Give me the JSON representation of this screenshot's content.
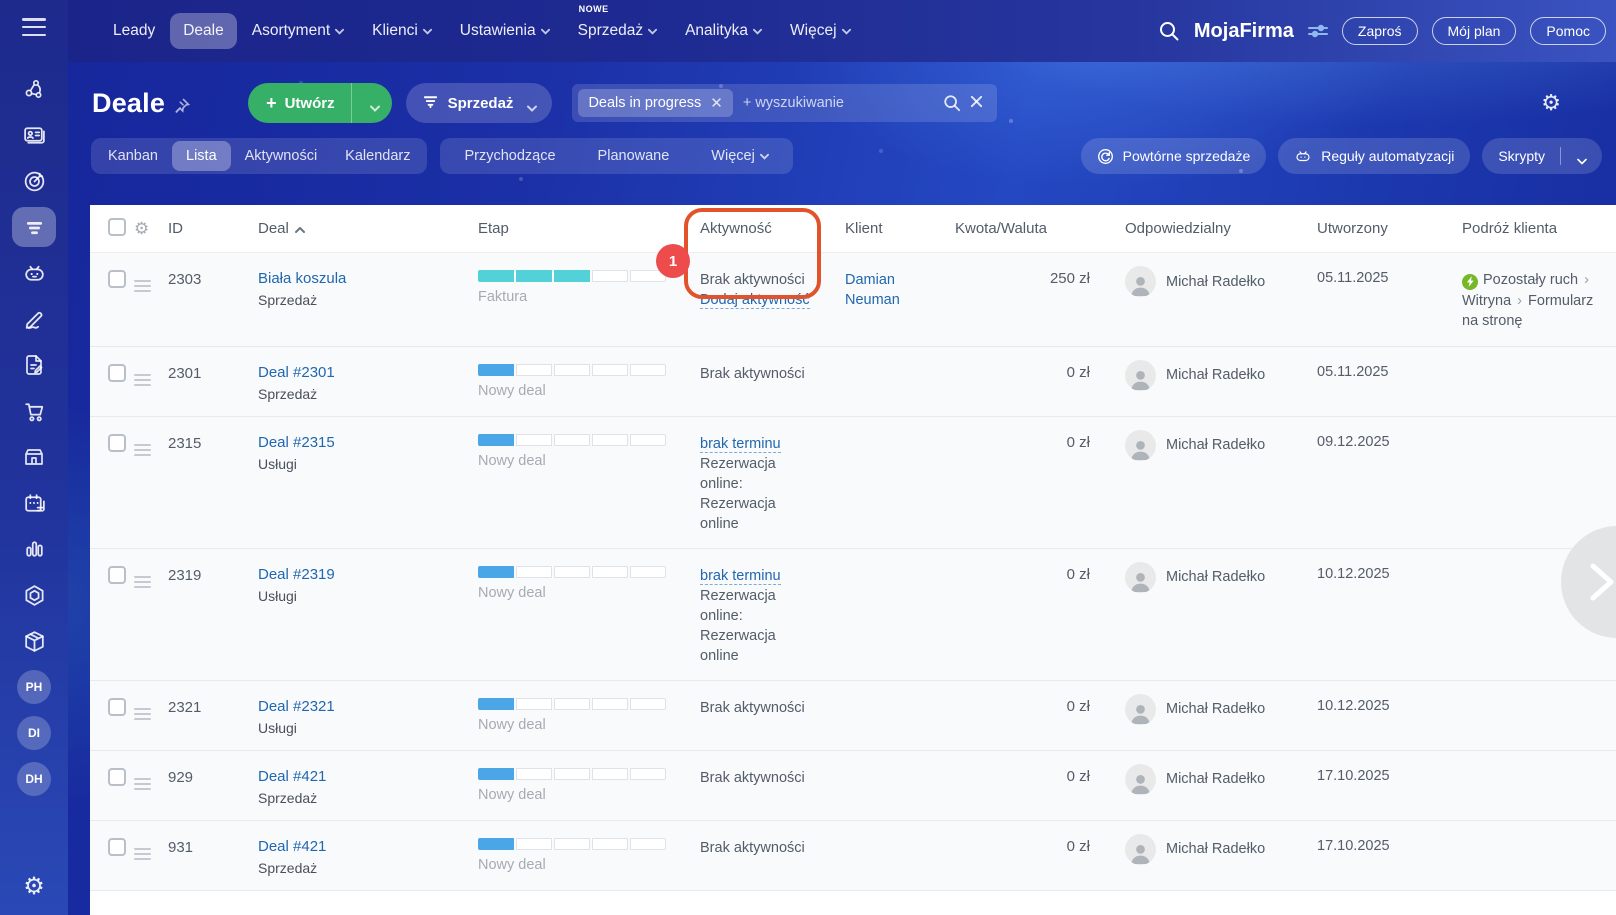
{
  "app": {
    "brand": "MojaFirma"
  },
  "topnav": {
    "items": [
      {
        "label": "Leady",
        "active": false
      },
      {
        "label": "Deale",
        "active": true
      },
      {
        "label": "Asortyment",
        "chevron": true
      },
      {
        "label": "Klienci",
        "chevron": true
      },
      {
        "label": "Ustawienia",
        "chevron": true
      },
      {
        "label": "Sprzedaż",
        "chevron": true,
        "badge": "NOWE"
      },
      {
        "label": "Analityka",
        "chevron": true
      },
      {
        "label": "Więcej",
        "chevron": true
      }
    ],
    "pills": [
      {
        "label": "Zaproś"
      },
      {
        "label": "Mój plan"
      },
      {
        "label": "Pomoc"
      }
    ]
  },
  "header": {
    "title": "Deale",
    "create_button": "Utwórz",
    "funnel_button": "Sprzedaż",
    "filter_chip": "Deals in progress",
    "search_placeholder": "+ wyszukiwanie"
  },
  "tabs": {
    "views": [
      {
        "label": "Kanban",
        "active": false
      },
      {
        "label": "Lista",
        "active": true
      },
      {
        "label": "Aktywności",
        "active": false
      },
      {
        "label": "Kalendarz",
        "active": false
      }
    ],
    "streams": [
      {
        "label": "Przychodzące"
      },
      {
        "label": "Planowane"
      },
      {
        "label": "Więcej",
        "chevron": true
      }
    ],
    "actions": [
      {
        "label": "Powtórne sprzedaże",
        "icon": "repeat-icon"
      },
      {
        "label": "Reguły automatyzacji",
        "icon": "robot-icon"
      },
      {
        "label": "Skrypty",
        "split_chevron": true
      }
    ]
  },
  "callout": {
    "badge": "1"
  },
  "table": {
    "columns": [
      "ID",
      "Deal",
      "Etap",
      "Aktywność",
      "Klient",
      "Kwota/Waluta",
      "Odpowiedzialny",
      "Utworzony",
      "Podróż klienta"
    ],
    "sorted_column": "Deal",
    "sort_direction": "asc",
    "rows": [
      {
        "id": "2303",
        "title": "Biała koszula",
        "category": "Sprzedaż",
        "stage": "Faktura",
        "progress": 3,
        "bar_color": "teal",
        "activity": {
          "text": "Brak aktywności",
          "link": "Dodaj aktywność",
          "link_position": "after"
        },
        "client": "Damian Neuman",
        "amount": "250 zł",
        "owner": "Michał Radełko",
        "created": "05.11.2025",
        "journey": {
          "icon": "organic-traffic-icon",
          "steps": [
            "Pozostały ruch",
            "Witryna",
            "Formularz na stronę"
          ]
        }
      },
      {
        "id": "2301",
        "title": "Deal #2301",
        "category": "Sprzedaż",
        "stage": "Nowy deal",
        "progress": 1,
        "bar_color": "blue",
        "activity": {
          "text": "Brak aktywności"
        },
        "amount": "0 zł",
        "owner": "Michał Radełko",
        "created": "05.11.2025"
      },
      {
        "id": "2315",
        "title": "Deal #2315",
        "category": "Usługi",
        "stage": "Nowy deal",
        "progress": 1,
        "bar_color": "blue",
        "activity": {
          "link": "brak terminu",
          "link_position": "before",
          "text": "Rezerwacja online: Rezerwacja online"
        },
        "amount": "0 zł",
        "owner": "Michał Radełko",
        "created": "09.12.2025"
      },
      {
        "id": "2319",
        "title": "Deal #2319",
        "category": "Usługi",
        "stage": "Nowy deal",
        "progress": 1,
        "bar_color": "blue",
        "activity": {
          "link": "brak terminu",
          "link_position": "before",
          "text": "Rezerwacja online: Rezerwacja online"
        },
        "amount": "0 zł",
        "owner": "Michał Radełko",
        "created": "10.12.2025"
      },
      {
        "id": "2321",
        "title": "Deal #2321",
        "category": "Usługi",
        "stage": "Nowy deal",
        "progress": 1,
        "bar_color": "blue",
        "activity": {
          "text": "Brak aktywności"
        },
        "amount": "0 zł",
        "owner": "Michał Radełko",
        "created": "10.12.2025"
      },
      {
        "id": "929",
        "title": "Deal #421",
        "category": "Sprzedaż",
        "stage": "Nowy deal",
        "progress": 1,
        "bar_color": "blue",
        "activity": {
          "text": "Brak aktywności"
        },
        "amount": "0 zł",
        "owner": "Michał Radełko",
        "created": "17.10.2025"
      },
      {
        "id": "931",
        "title": "Deal #421",
        "category": "Sprzedaż",
        "stage": "Nowy deal",
        "progress": 1,
        "bar_color": "blue",
        "activity": {
          "text": "Brak aktywności"
        },
        "amount": "0 zł",
        "owner": "Michał Radełko",
        "created": "17.10.2025"
      }
    ]
  },
  "sidebar": {
    "avatars": [
      "PH",
      "DI",
      "DH"
    ]
  },
  "colors": {
    "accent_green": "#35b066",
    "bar_blue": "#4aa6e6",
    "bar_teal": "#52d2d8",
    "link_blue": "#2067b0",
    "callout_orange": "#e2532c",
    "badge_red": "#ee4c4c",
    "journey_green": "#76b82a",
    "nav_navy": "#1e2b92"
  }
}
